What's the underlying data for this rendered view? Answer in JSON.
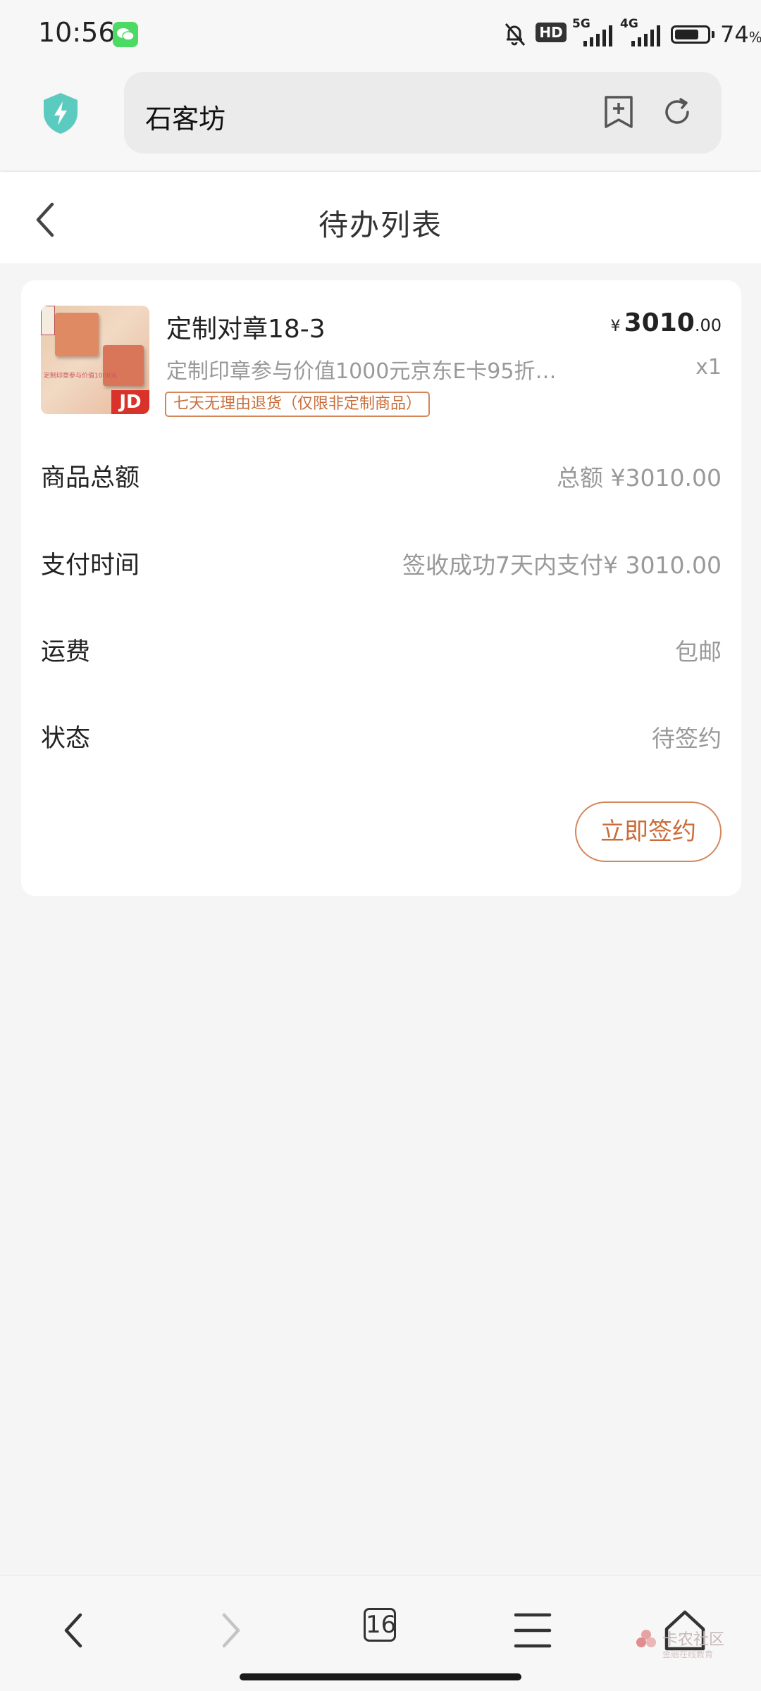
{
  "status_bar": {
    "time": "10:56",
    "hd_label": "HD",
    "net1": "5G",
    "net2": "4G",
    "battery_percent": "74",
    "battery_unit": "%",
    "battery_level": 0.74
  },
  "browser": {
    "address_text": "石客坊"
  },
  "header": {
    "title": "待办列表"
  },
  "order": {
    "product_name": "定制对章18-3",
    "product_desc": "定制印章参与价值1000元京东E卡95折…",
    "return_policy": "七天无理由退货（仅限非定制商品）",
    "price_currency": "¥",
    "price_integer": "3010",
    "price_decimal": ".00",
    "quantity": "x1",
    "thumb_jd": "JD",
    "thumb_caption": "定制印章参与价值1000元",
    "rows": [
      {
        "label": "商品总额",
        "value": "总额 ¥3010.00"
      },
      {
        "label": "支付时间",
        "value": "签收成功7天内支付¥ 3010.00"
      },
      {
        "label": "运费",
        "value": "包邮"
      },
      {
        "label": "状态",
        "value": "待签约"
      }
    ],
    "sign_button": "立即签约"
  },
  "toolbar": {
    "tab_count": "16"
  },
  "watermark": {
    "text": "卡农社区",
    "sub": "金融在线教育"
  },
  "colors": {
    "accent": "#c96d3a",
    "accent_border": "#d4875a",
    "shield": "#5ccbbf"
  }
}
